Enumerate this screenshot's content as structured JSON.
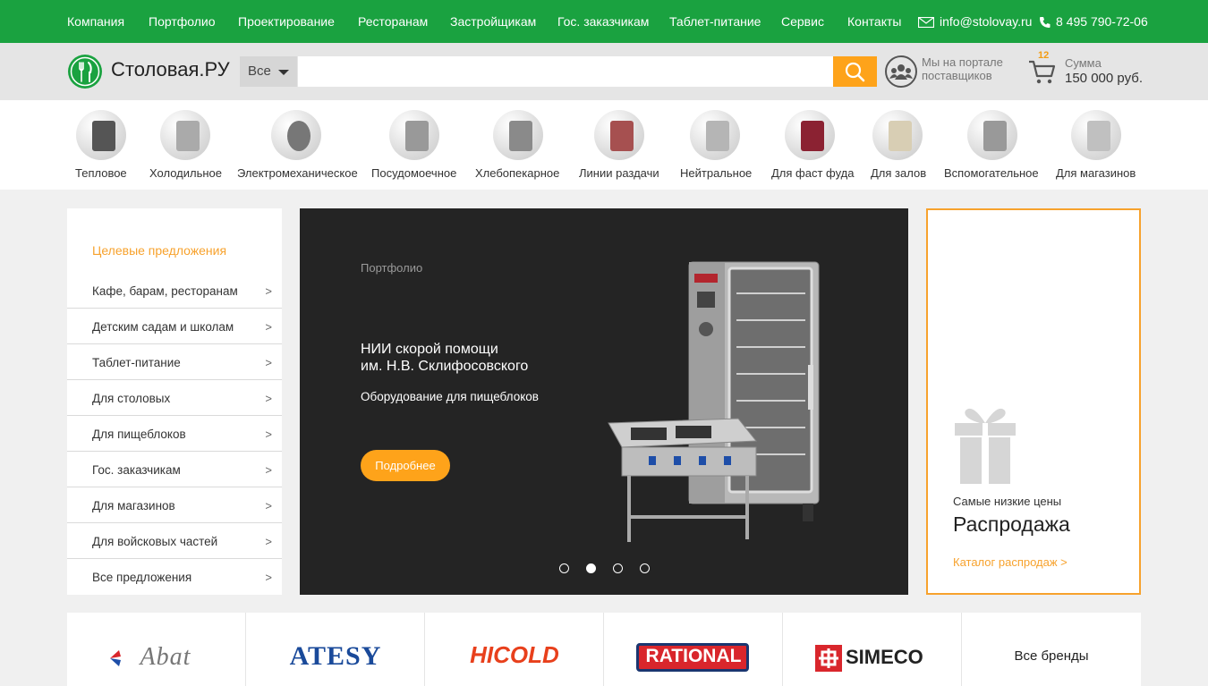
{
  "topnav": {
    "items": [
      "Компания",
      "Портфолио",
      "Проектирование",
      "Ресторанам",
      "Застройщикам",
      "Гос. заказчикам",
      "Таблет-питание",
      "Сервис",
      "Контакты"
    ],
    "email": "info@stolovay.ru",
    "phone": "8 495 790-72-06"
  },
  "header": {
    "logo_text": "Столовая.РУ",
    "search_scope": "Все",
    "search_value": "",
    "portal_text": "Мы на портале поставщиков",
    "cart_count": "12",
    "cart_sum_label": "Сумма",
    "cart_sum": "150 000 руб."
  },
  "categories": [
    "Тепловое",
    "Холодильное",
    "Электромеханическое",
    "Посудомоечное",
    "Хлебопекарное",
    "Линии раздачи",
    "Нейтральное",
    "Для фаст фуда",
    "Для залов",
    "Вспомогательное",
    "Для магазинов"
  ],
  "left_menu": {
    "title": "Целевые предложения",
    "items": [
      "Кафе, барам, ресторанам",
      "Детским садам и школам",
      "Таблет-питание",
      "Для столовых",
      "Для пищеблоков",
      "Гос. заказчикам",
      "Для магазинов",
      "Для войсковых частей",
      "Все предложения"
    ],
    "arrow": ">"
  },
  "hero": {
    "category": "Портфолио",
    "title_line1": "НИИ скорой помощи",
    "title_line2": "им. Н.В. Склифосовского",
    "subtitle": "Оборудование для пищеблоков",
    "button": "Подробнее",
    "slides_total": 4,
    "active_slide": 2
  },
  "sale": {
    "subtitle": "Самые низкие цены",
    "title": "Распродажа",
    "link": "Каталог распродаж  >"
  },
  "brands": {
    "items": [
      "Abat",
      "ATESY",
      "HICOLD",
      "RATIONAL",
      "SIMECO"
    ],
    "all_label": "Все бренды"
  },
  "colors": {
    "green": "#1aa240",
    "orange": "#fea31a",
    "dark": "#242424"
  }
}
